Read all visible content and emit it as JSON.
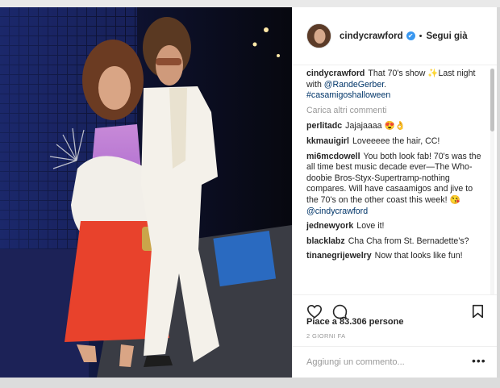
{
  "post": {
    "username": "cindycrawford",
    "verified_icon": "verified-badge-icon",
    "separator": "•",
    "follow_label": "Segui già",
    "load_more": "Carica altri commenti",
    "likes": "Piace a 83.306 persone",
    "age": "2 GIORNI FA",
    "add_comment_placeholder": "Aggiungi un commento...",
    "more_options": "•••"
  },
  "caption": {
    "user": "cindycrawford",
    "text_before": "That 70's show ✨Last night with ",
    "mention": "@RandeGerber",
    "text_after": ".",
    "hashtag": "#casamigoshalloween"
  },
  "comments": [
    {
      "user": "perlitadc",
      "text": "Jajajaaaa 😍👌"
    },
    {
      "user": "kkmauigirl",
      "text": "Loveeeee the hair, CC!"
    },
    {
      "user": "mi6mcdowell",
      "text": "You both look fab! 70's was the all time best music decade ever—The Who-doobie Bros-Styx-Supertramp-nothing compares. Will have casaamigos and jive to the 70's on the other coast this week! 😘",
      "mention": "@cindycrawford"
    },
    {
      "user": "jednewyork",
      "text": "Love it!"
    },
    {
      "user": "blacklabz",
      "text": "Cha Cha from St. Bernadette's?"
    },
    {
      "user": "tinanegrijewelry",
      "text": "Now that looks like fun!"
    }
  ],
  "icons": [
    "heart-icon",
    "comment-icon",
    "bookmark-icon",
    "verified-badge-icon"
  ],
  "colors": {
    "link": "#003569",
    "muted": "#999999",
    "text": "#262626",
    "verified": "#3897f0"
  }
}
